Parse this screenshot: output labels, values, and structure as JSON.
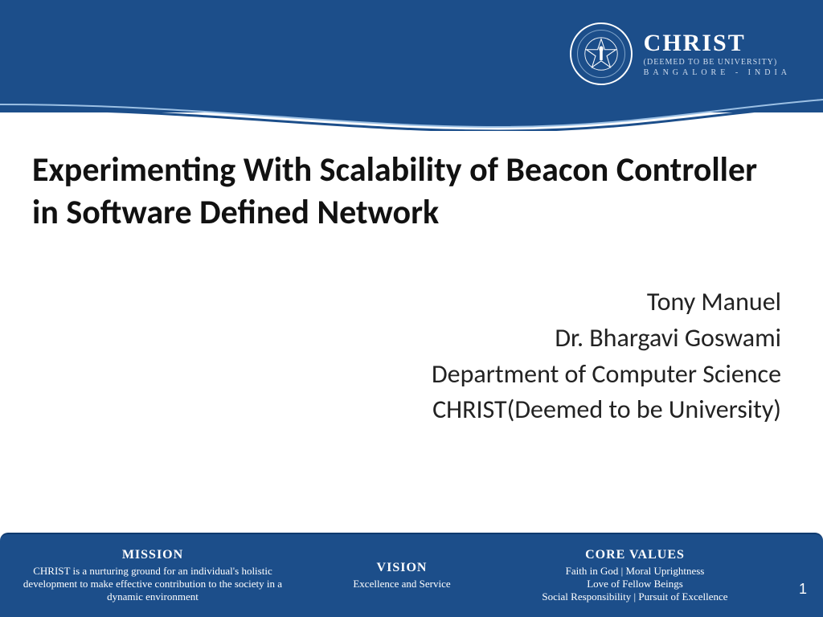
{
  "header": {
    "logo_main": "CHRIST",
    "logo_sub1": "(DEEMED TO BE UNIVERSITY)",
    "logo_sub2": "BANGALORE - INDIA"
  },
  "title": "Experimenting With Scalability of Beacon Controller in Software Defined Network",
  "authors": {
    "line1": "Tony Manuel",
    "line2": "Dr. Bhargavi Goswami",
    "line3": "Department of Computer Science",
    "line4": "CHRIST(Deemed to be University)"
  },
  "footer": {
    "mission": {
      "heading": "MISSION",
      "body": "CHRIST is a nurturing ground for an individual's holistic development to make effective contribution to the society in a dynamic environment"
    },
    "vision": {
      "heading": "VISION",
      "body": "Excellence and Service"
    },
    "values": {
      "heading": "CORE  VALUES",
      "body1": "Faith in God |  Moral Uprightness",
      "body2": "Love of Fellow Beings",
      "body3": "Social Responsibility | Pursuit of Excellence"
    }
  },
  "slide_number": "1"
}
